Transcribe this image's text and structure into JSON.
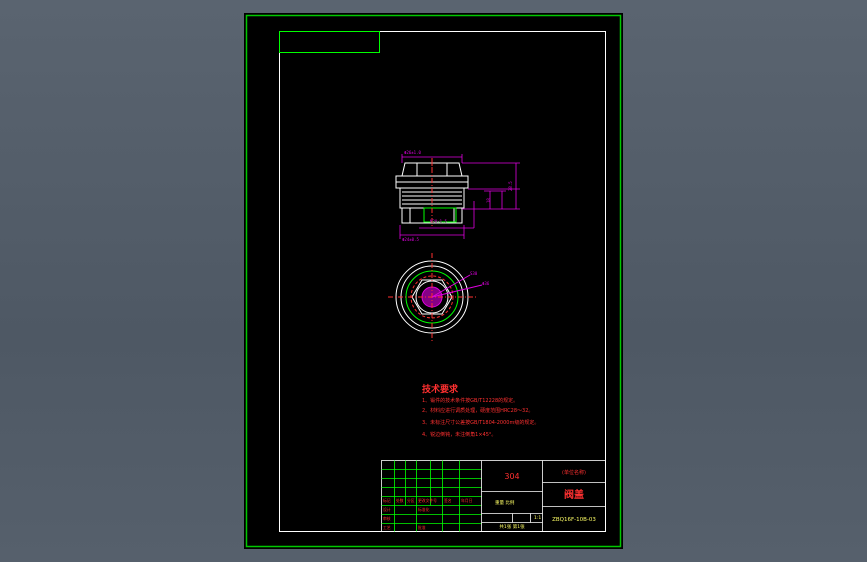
{
  "drawing": {
    "material": "304",
    "part_name": "阀盖",
    "drawing_number": "ZBQ16F-10B-03",
    "company_label": "(单位名称)",
    "scale": "1:1",
    "sheet_info": "共1张 第1张",
    "mass_scale_label": "重量 比例",
    "title_block_labels": [
      "标记",
      "处数",
      "分区",
      "更改文件号",
      "签名",
      "年月日",
      "设计",
      "标准化",
      "审核",
      "工艺",
      "批准"
    ],
    "tech_requirements": {
      "heading": "技术要求",
      "items": [
        "1、锻件的技术条件按GB/T12228的规定。",
        "2、材料应进行调质处理，硬度范围HRC28～32。",
        "3、未标注尺寸公差按GB/T1804-2000m级的规定。",
        "4、锐边倒钝，未注倒角1×45°。"
      ]
    },
    "dims": {
      "top_width": "Φ26±1.0",
      "overall_height": "28.5",
      "thread_len": "18",
      "thread": "M30×1.5",
      "base_dia": "Φ24±0.5",
      "hex_note": "S30",
      "plan_view_dia": "Φ36"
    }
  },
  "colors": {
    "border": "#00c800",
    "frame": "#ffffff",
    "geometry": "#ffffff",
    "dimension": "#e000e0",
    "text_red": "#ff3030",
    "table_green": "#00ff00",
    "title_text": "#ffff66"
  }
}
